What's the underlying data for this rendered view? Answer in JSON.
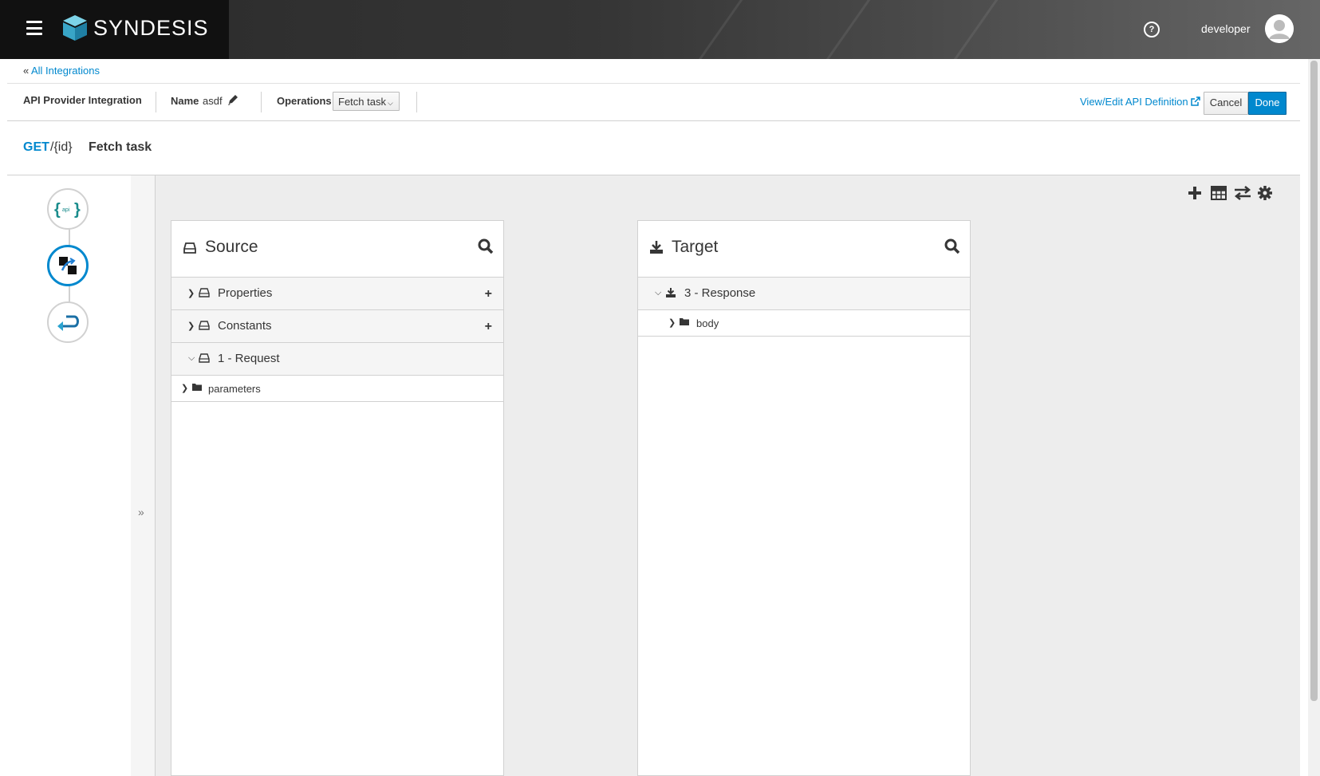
{
  "masthead": {
    "brand": "SYNDESIS",
    "username": "developer",
    "icons": {
      "menu": "hamburger-icon",
      "help": "question-circle-icon",
      "avatar": "user-avatar-icon"
    }
  },
  "breadcrumb": {
    "prefix": "«",
    "link": "All Integrations"
  },
  "toolbar": {
    "title": "API Provider Integration",
    "name_label": "Name",
    "name_value": "asdf",
    "operations_label": "Operations",
    "operation_selected": "Fetch task",
    "view_edit_label": "View/Edit API Definition",
    "cancel_label": "Cancel",
    "done_label": "Done"
  },
  "flow_header": {
    "method": "GET",
    "path": "/{id}",
    "operation": "Fetch task"
  },
  "flow_steps": [
    {
      "name": "api-provider-step",
      "icon": "api-icon"
    },
    {
      "name": "data-mapper-step",
      "icon": "mapper-icon",
      "active": true
    },
    {
      "name": "return-step",
      "icon": "return-arrow-icon"
    }
  ],
  "collapse_label": "»",
  "mapper": {
    "toolbar_icons": [
      "plus-icon",
      "table-icon",
      "exchange-icon",
      "gear-icon"
    ],
    "source": {
      "title": "Source",
      "documents": [
        {
          "label": "Properties",
          "expanded": false,
          "addable": true
        },
        {
          "label": "Constants",
          "expanded": false,
          "addable": true
        },
        {
          "label": "1 - Request",
          "expanded": true,
          "addable": false
        }
      ],
      "fields": [
        {
          "label": "parameters"
        }
      ]
    },
    "target": {
      "title": "Target",
      "documents": [
        {
          "label": "3 - Response",
          "expanded": true
        }
      ],
      "fields": [
        {
          "label": "body"
        }
      ]
    }
  },
  "colors": {
    "accent": "#0088ce",
    "masthead": "#2a2a2a",
    "canvas": "#ededed"
  }
}
